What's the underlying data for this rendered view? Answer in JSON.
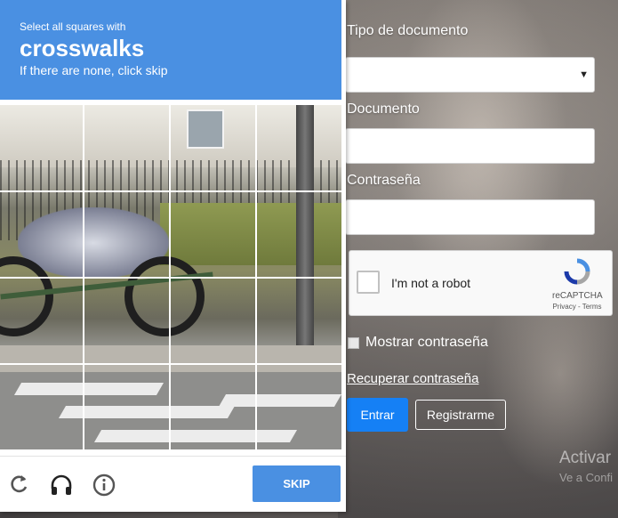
{
  "challenge": {
    "instruction": "Select all squares with",
    "target": "crosswalks",
    "hint": "If there are none, click skip",
    "skip_label": "SKIP",
    "icons": [
      "reload-icon",
      "audio-icon",
      "info-icon"
    ]
  },
  "form": {
    "doc_type_label": "Tipo de documento",
    "doc_type_value": "",
    "document_label": "Documento",
    "document_value": "",
    "password_label": "Contraseña",
    "password_value": "",
    "show_password_label": "Mostrar contraseña",
    "recover_label": "Recuperar contraseña",
    "enter_label": "Entrar",
    "register_label": "Registrarme"
  },
  "recaptcha": {
    "label": "I'm not a robot",
    "brand": "reCAPTCHA",
    "links": "Privacy - Terms"
  },
  "watermark": {
    "title": "Activar",
    "subtitle": "Ve a Confi"
  },
  "colors": {
    "accent": "#4a90e2",
    "enter_button": "#1580f5"
  }
}
